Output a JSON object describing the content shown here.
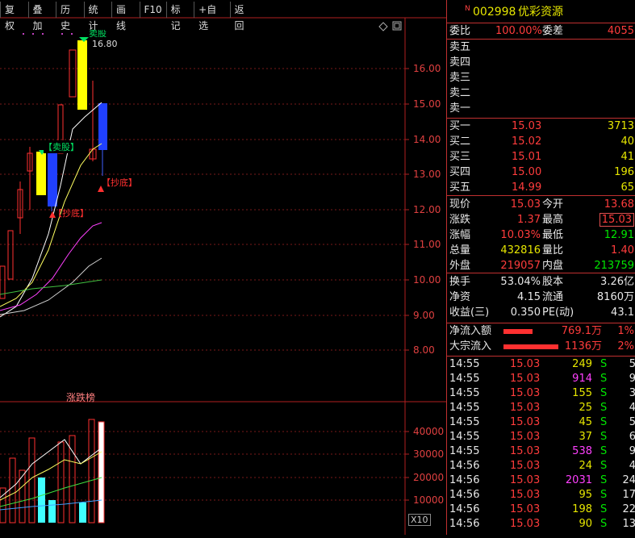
{
  "toolbar": [
    "复权",
    "叠加",
    "历史",
    "统计",
    "画线",
    "F10",
    "标记",
    "+自选",
    "返回"
  ],
  "kline": {
    "price_ticks": [
      "16.00",
      "15.00",
      "14.00",
      "13.00",
      "12.00",
      "11.00",
      "10.00",
      "9.00",
      "8.00"
    ],
    "high_label": "16.80",
    "sell_signal_top": "卖股",
    "sell_signal": "【卖股】",
    "bottom_signal_1": "【抄底】",
    "bottom_signal_2": "【抄底】"
  },
  "volume": {
    "indicator_name": "涨跌榜",
    "ticks": [
      "40000",
      "30000",
      "20000",
      "10000"
    ],
    "unit": "X10"
  },
  "stock": {
    "flag": "N",
    "code": "002998",
    "name": "优彩资源"
  },
  "ratio": {
    "label": "委比",
    "value": "100.00%",
    "diff_label": "委差",
    "diff_value": "4055"
  },
  "sells": [
    "卖五",
    "卖四",
    "卖三",
    "卖二",
    "卖一"
  ],
  "buys": [
    {
      "label": "买一",
      "price": "15.03",
      "vol": "3713"
    },
    {
      "label": "买二",
      "price": "15.02",
      "vol": "40"
    },
    {
      "label": "买三",
      "price": "15.01",
      "vol": "41"
    },
    {
      "label": "买四",
      "price": "15.00",
      "vol": "196"
    },
    {
      "label": "买五",
      "price": "14.99",
      "vol": "65"
    }
  ],
  "stats": [
    {
      "l1": "现价",
      "v1": "15.03",
      "l2": "今开",
      "v2": "13.68"
    },
    {
      "l1": "涨跌",
      "v1": "1.37",
      "l2": "最高",
      "v2": "15.03"
    },
    {
      "l1": "涨幅",
      "v1": "10.03%",
      "l2": "最低",
      "v2": "12.91"
    },
    {
      "l1": "总量",
      "v1": "432816",
      "l2": "量比",
      "v2": "1.40"
    },
    {
      "l1": "外盘",
      "v1": "219057",
      "l2": "内盘",
      "v2": "213759"
    }
  ],
  "fund": [
    {
      "l1": "换手",
      "v1": "53.04%",
      "l2": "股本",
      "v2": "3.26亿"
    },
    {
      "l1": "净资",
      "v1": "4.15",
      "l2": "流通",
      "v2": "8160万"
    },
    {
      "l1": "收益(三)",
      "v1": "0.350",
      "l2": "PE(动)",
      "v2": "43.1"
    }
  ],
  "flows": [
    {
      "label": "净流入额",
      "value": "769.1万",
      "pct": "1%",
      "fill": 0.36
    },
    {
      "label": "大宗流入",
      "value": "1136万",
      "pct": "2%",
      "fill": 0.68
    }
  ],
  "ticks": [
    {
      "t": "14:55",
      "p": "15.03",
      "v": "249",
      "s": "S",
      "n": "5"
    },
    {
      "t": "14:55",
      "p": "15.03",
      "v": "914",
      "s": "S",
      "n": "9"
    },
    {
      "t": "14:55",
      "p": "15.03",
      "v": "155",
      "s": "S",
      "n": "3"
    },
    {
      "t": "14:55",
      "p": "15.03",
      "v": "25",
      "s": "S",
      "n": "4"
    },
    {
      "t": "14:55",
      "p": "15.03",
      "v": "45",
      "s": "S",
      "n": "5"
    },
    {
      "t": "14:55",
      "p": "15.03",
      "v": "37",
      "s": "S",
      "n": "6"
    },
    {
      "t": "14:55",
      "p": "15.03",
      "v": "538",
      "s": "S",
      "n": "9"
    },
    {
      "t": "14:56",
      "p": "15.03",
      "v": "24",
      "s": "S",
      "n": "4"
    },
    {
      "t": "14:56",
      "p": "15.03",
      "v": "2031",
      "s": "S",
      "n": "24"
    },
    {
      "t": "14:56",
      "p": "15.03",
      "v": "95",
      "s": "S",
      "n": "17"
    },
    {
      "t": "14:56",
      "p": "15.03",
      "v": "198",
      "s": "S",
      "n": "22"
    },
    {
      "t": "14:56",
      "p": "15.03",
      "v": "90",
      "s": "S",
      "n": "13"
    }
  ]
}
